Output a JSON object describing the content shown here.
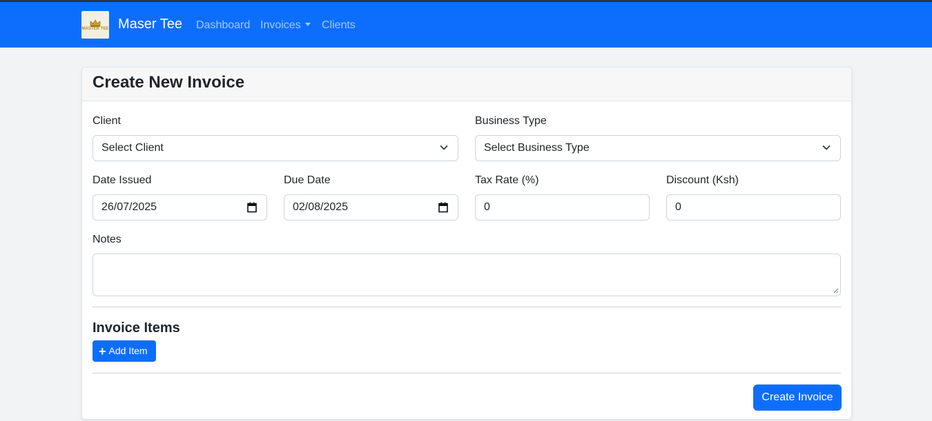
{
  "colors": {
    "navbar": "#0d6efd",
    "primary_button": "#0d6efd",
    "page_background": "#f1f3f5"
  },
  "navbar": {
    "logo_text": "MASTER TEE",
    "brand": "Maser Tee",
    "links": [
      {
        "label": "Dashboard"
      },
      {
        "label": "Invoices",
        "dropdown": true
      },
      {
        "label": "Clients"
      }
    ]
  },
  "form": {
    "title": "Create New Invoice",
    "client": {
      "label": "Client",
      "value": "Select Client"
    },
    "business_type": {
      "label": "Business Type",
      "value": "Select Business Type"
    },
    "date_issued": {
      "label": "Date Issued",
      "value": "26/07/2025"
    },
    "due_date": {
      "label": "Due Date",
      "value": "02/08/2025"
    },
    "tax_rate": {
      "label": "Tax Rate (%)",
      "value": "0"
    },
    "discount": {
      "label": "Discount (Ksh)",
      "value": "0"
    },
    "notes": {
      "label": "Notes",
      "value": ""
    },
    "items_section": {
      "title": "Invoice Items",
      "add_item_label": "Add Item"
    },
    "submit_label": "Create Invoice"
  },
  "icons": [
    "crown-icon",
    "chevron-down-icon",
    "calendar-icon",
    "plus-icon",
    "resize-grip-icon"
  ]
}
